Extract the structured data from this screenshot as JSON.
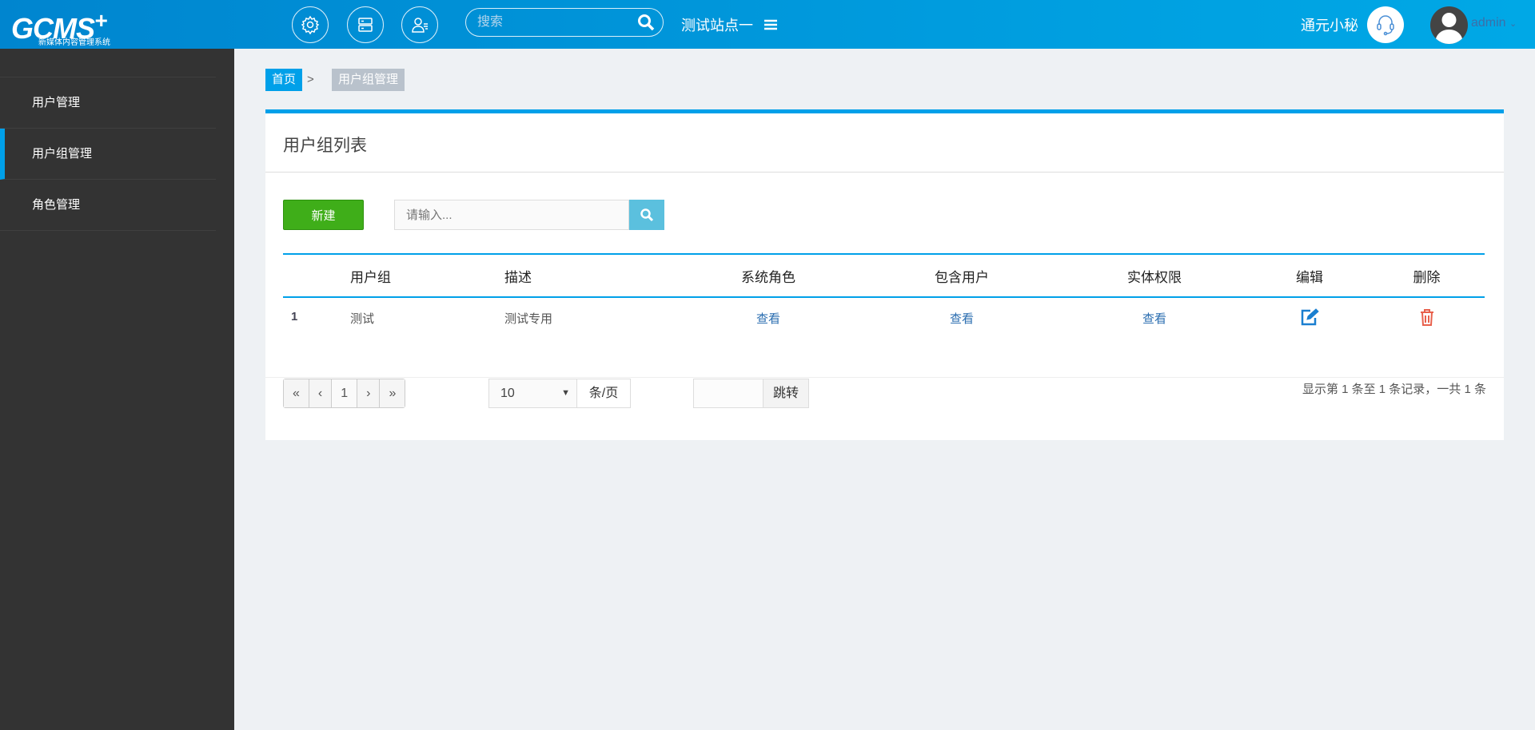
{
  "header": {
    "logo_main": "CMS",
    "logo_plus": "+",
    "logo_sub": "新媒体内容管理系统",
    "search_placeholder": "搜索",
    "site": "测试站点一",
    "assistant": "通元小秘",
    "user": "admin"
  },
  "sidebar": {
    "items": [
      {
        "label": "用户管理"
      },
      {
        "label": "用户组管理",
        "active": true
      },
      {
        "label": "角色管理"
      }
    ]
  },
  "breadcrumb": {
    "home": "首页",
    "sep": ">",
    "current": "用户组管理"
  },
  "panel": {
    "title": "用户组列表",
    "new_label": "新建",
    "search_placeholder": "请输入..."
  },
  "table": {
    "headers": [
      "",
      "用户组",
      "描述",
      "系统角色",
      "包含用户",
      "实体权限",
      "编辑",
      "删除"
    ],
    "rows": [
      {
        "num": "1",
        "group": "测试",
        "desc": "测试专用",
        "roles": "查看",
        "users": "查看",
        "perms": "查看"
      }
    ]
  },
  "pagination": {
    "first": "«",
    "prev": "‹",
    "page": "1",
    "next": "›",
    "last": "»",
    "page_size": "10",
    "unit": "条/页",
    "jump": "跳转",
    "info": "显示第 1 条至 1 条记录，一共 1 条"
  },
  "colors": {
    "accent": "#00a0e9",
    "new_button": "#3fae19",
    "sidebar": "#333333",
    "delete": "#e8604c"
  }
}
